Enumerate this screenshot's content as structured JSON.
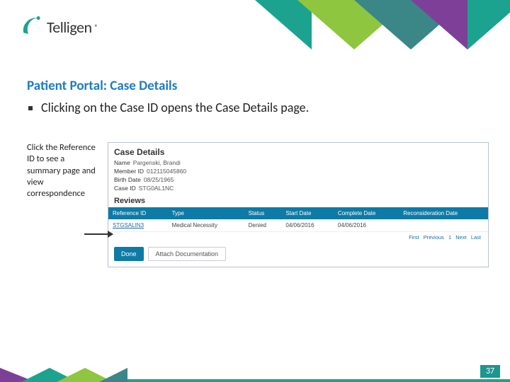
{
  "logo": {
    "text": "Telligen"
  },
  "slide": {
    "heading": "Patient Portal:  Case Details",
    "bullets": [
      "Clicking on the Case ID opens the Case Details page."
    ],
    "callout": "Click the Reference ID to see a summary page and view correspondence"
  },
  "case_details": {
    "title": "Case Details",
    "fields": {
      "name_label": "Name",
      "name_value": "Pargenski, Brandi",
      "member_label": "Member ID",
      "member_value": "012115045860",
      "birth_label": "Birth Date",
      "birth_value": "08/25/1965",
      "case_label": "Case ID",
      "case_value": "STG0AL1NC"
    },
    "reviews_label": "Reviews",
    "columns": [
      "Reference ID",
      "Type",
      "Status",
      "Start Date",
      "Complete Date",
      "Reconsideration Date"
    ],
    "row": {
      "ref": "STGSALIN3",
      "type": "Medical Necessity",
      "status": "Denied",
      "start": "04/06/2016",
      "complete": "04/06/2016",
      "recon": ""
    },
    "pager": {
      "first": "First",
      "prev": "Previous",
      "page": "1",
      "next": "Next",
      "last": "Last"
    },
    "buttons": {
      "done": "Done",
      "attach": "Attach Documentation"
    }
  },
  "page_number": "37"
}
